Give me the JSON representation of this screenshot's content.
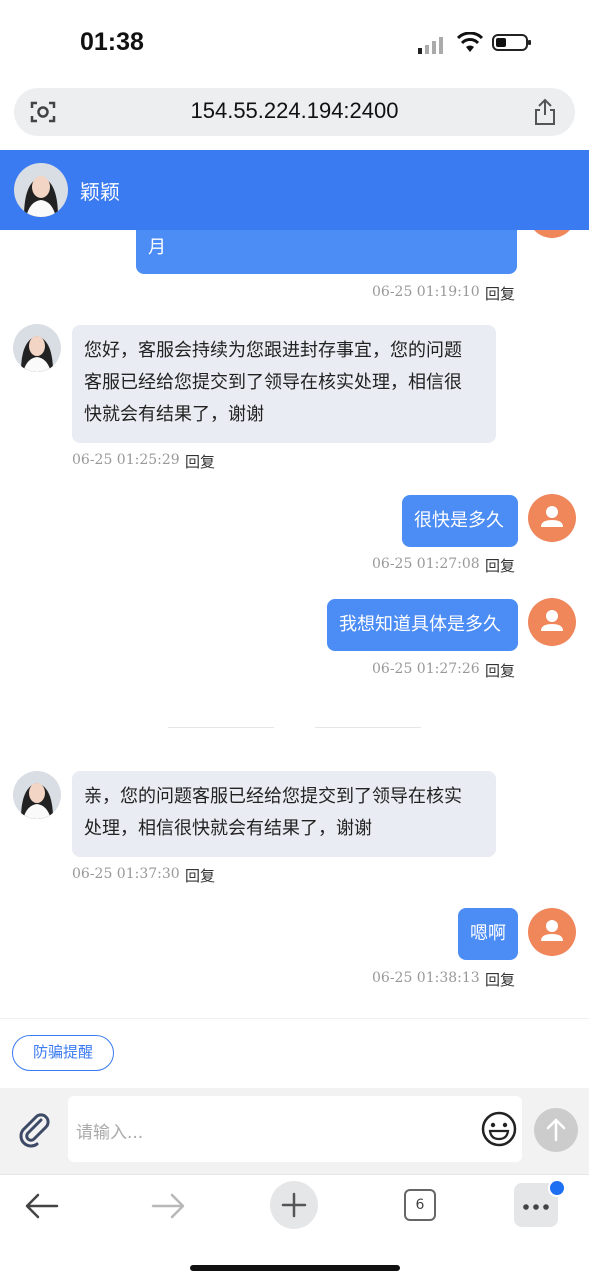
{
  "status_bar": {
    "time": "01:38"
  },
  "browser": {
    "url": "154.55.224.194:2400",
    "tab_count": "6"
  },
  "chat_header": {
    "name": "颖颖"
  },
  "messages": [
    {
      "direction": "out",
      "text": "月",
      "time": "06-25 01:19:10",
      "reply": "回复"
    },
    {
      "direction": "in",
      "lines": [
        "您好，客服会持续为您跟进封存事宜，您的问题",
        "客服已经给您提交到了领导在核实处理，相信很",
        "快就会有结果了，谢谢"
      ],
      "time": "06-25 01:25:29",
      "reply": "回复"
    },
    {
      "direction": "out",
      "text": "很快是多久",
      "time": "06-25 01:27:08",
      "reply": "回复"
    },
    {
      "direction": "out",
      "text": "我想知道具体是多久",
      "time": "06-25 01:27:26",
      "reply": "回复"
    },
    {
      "direction": "in",
      "lines": [
        "亲，您的问题客服已经给您提交到了领导在核实",
        "处理，相信很快就会有结果了，谢谢"
      ],
      "time": "06-25 01:37:30",
      "reply": "回复"
    },
    {
      "direction": "out",
      "text": "嗯啊",
      "time": "06-25 01:38:13",
      "reply": "回复"
    }
  ],
  "quick_actions": {
    "anti_fraud": "防骗提醒"
  },
  "input": {
    "placeholder": "请输入..."
  },
  "colors": {
    "header": "#3a7bf1",
    "out_bubble": "#4c8cf5",
    "in_bubble": "#e9ecf2",
    "user_avatar": "#f0875a"
  }
}
